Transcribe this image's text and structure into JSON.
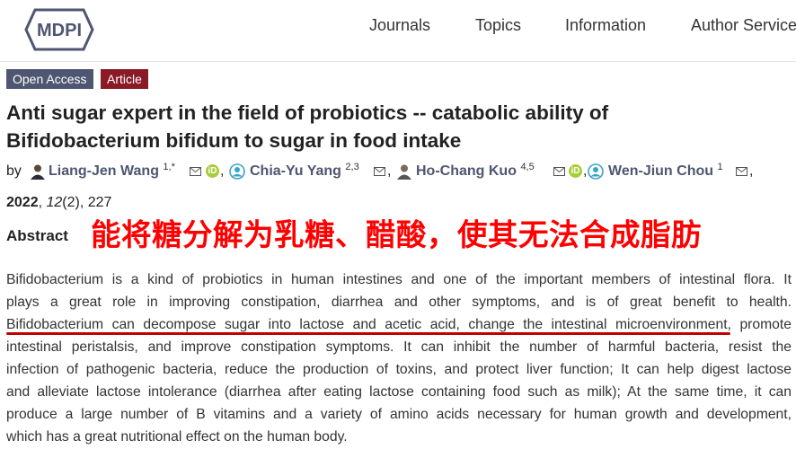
{
  "header": {
    "logo_text": "MDPI",
    "nav": [
      "Journals",
      "Topics",
      "Information",
      "Author Service"
    ]
  },
  "badges": {
    "open_access": "Open Access",
    "article": "Article"
  },
  "title_lines": [
    "Anti sugar expert in the field of probiotics -- catabolic ability of",
    "Bifidobacterium bifidum to sugar in food intake"
  ],
  "authors": {
    "by": "by",
    "list": [
      {
        "name": "Liang-Jen Wang",
        "aff": "1,*"
      },
      {
        "name": "Chia-Yu Yang",
        "aff": "2,3"
      },
      {
        "name": "Ho-Chang Kuo",
        "aff": "4,5"
      },
      {
        "name": "Wen-Jiun Chou",
        "aff": "1"
      }
    ],
    "separator": ","
  },
  "citation": {
    "year": "2022",
    "volume": "12",
    "rest": "(2), 227",
    "sep": ", "
  },
  "abstract": {
    "heading": "Abstract",
    "annotation": "能将糖分解为乳糖、醋酸，使其无法合成脂肪",
    "lines": [
      "Bifidobacterium is a kind of probiotics in human intestines and one of the important members of intestinal flora. It",
      "plays a great role in improving constipation, diarrhea and other symptoms, and is of great benefit to health.",
      "Bifidobacterium can decompose sugar into lactose and acetic acid, change the intestinal microenvironment, promote",
      "intestinal peristalsis, and improve constipation symptoms. It can inhibit the number of harmful bacteria, resist the",
      "infection of pathogenic bacteria, reduce the production of toxins, and protect liver function; It can help digest lactose",
      "and alleviate lactose intolerance (diarrhea after eating lactose containing food such as milk); At the same time, it can",
      "produce a large number of B vitamins and a variety of amino acids necessary for human growth and development,",
      "which has a great nutritional effect on the human body."
    ]
  },
  "colors": {
    "badge_oa": "#4f5671",
    "badge_article": "#8a1a25",
    "annotation": "#ff0000",
    "underline": "#c00000",
    "orcid": "#a6ce39"
  }
}
